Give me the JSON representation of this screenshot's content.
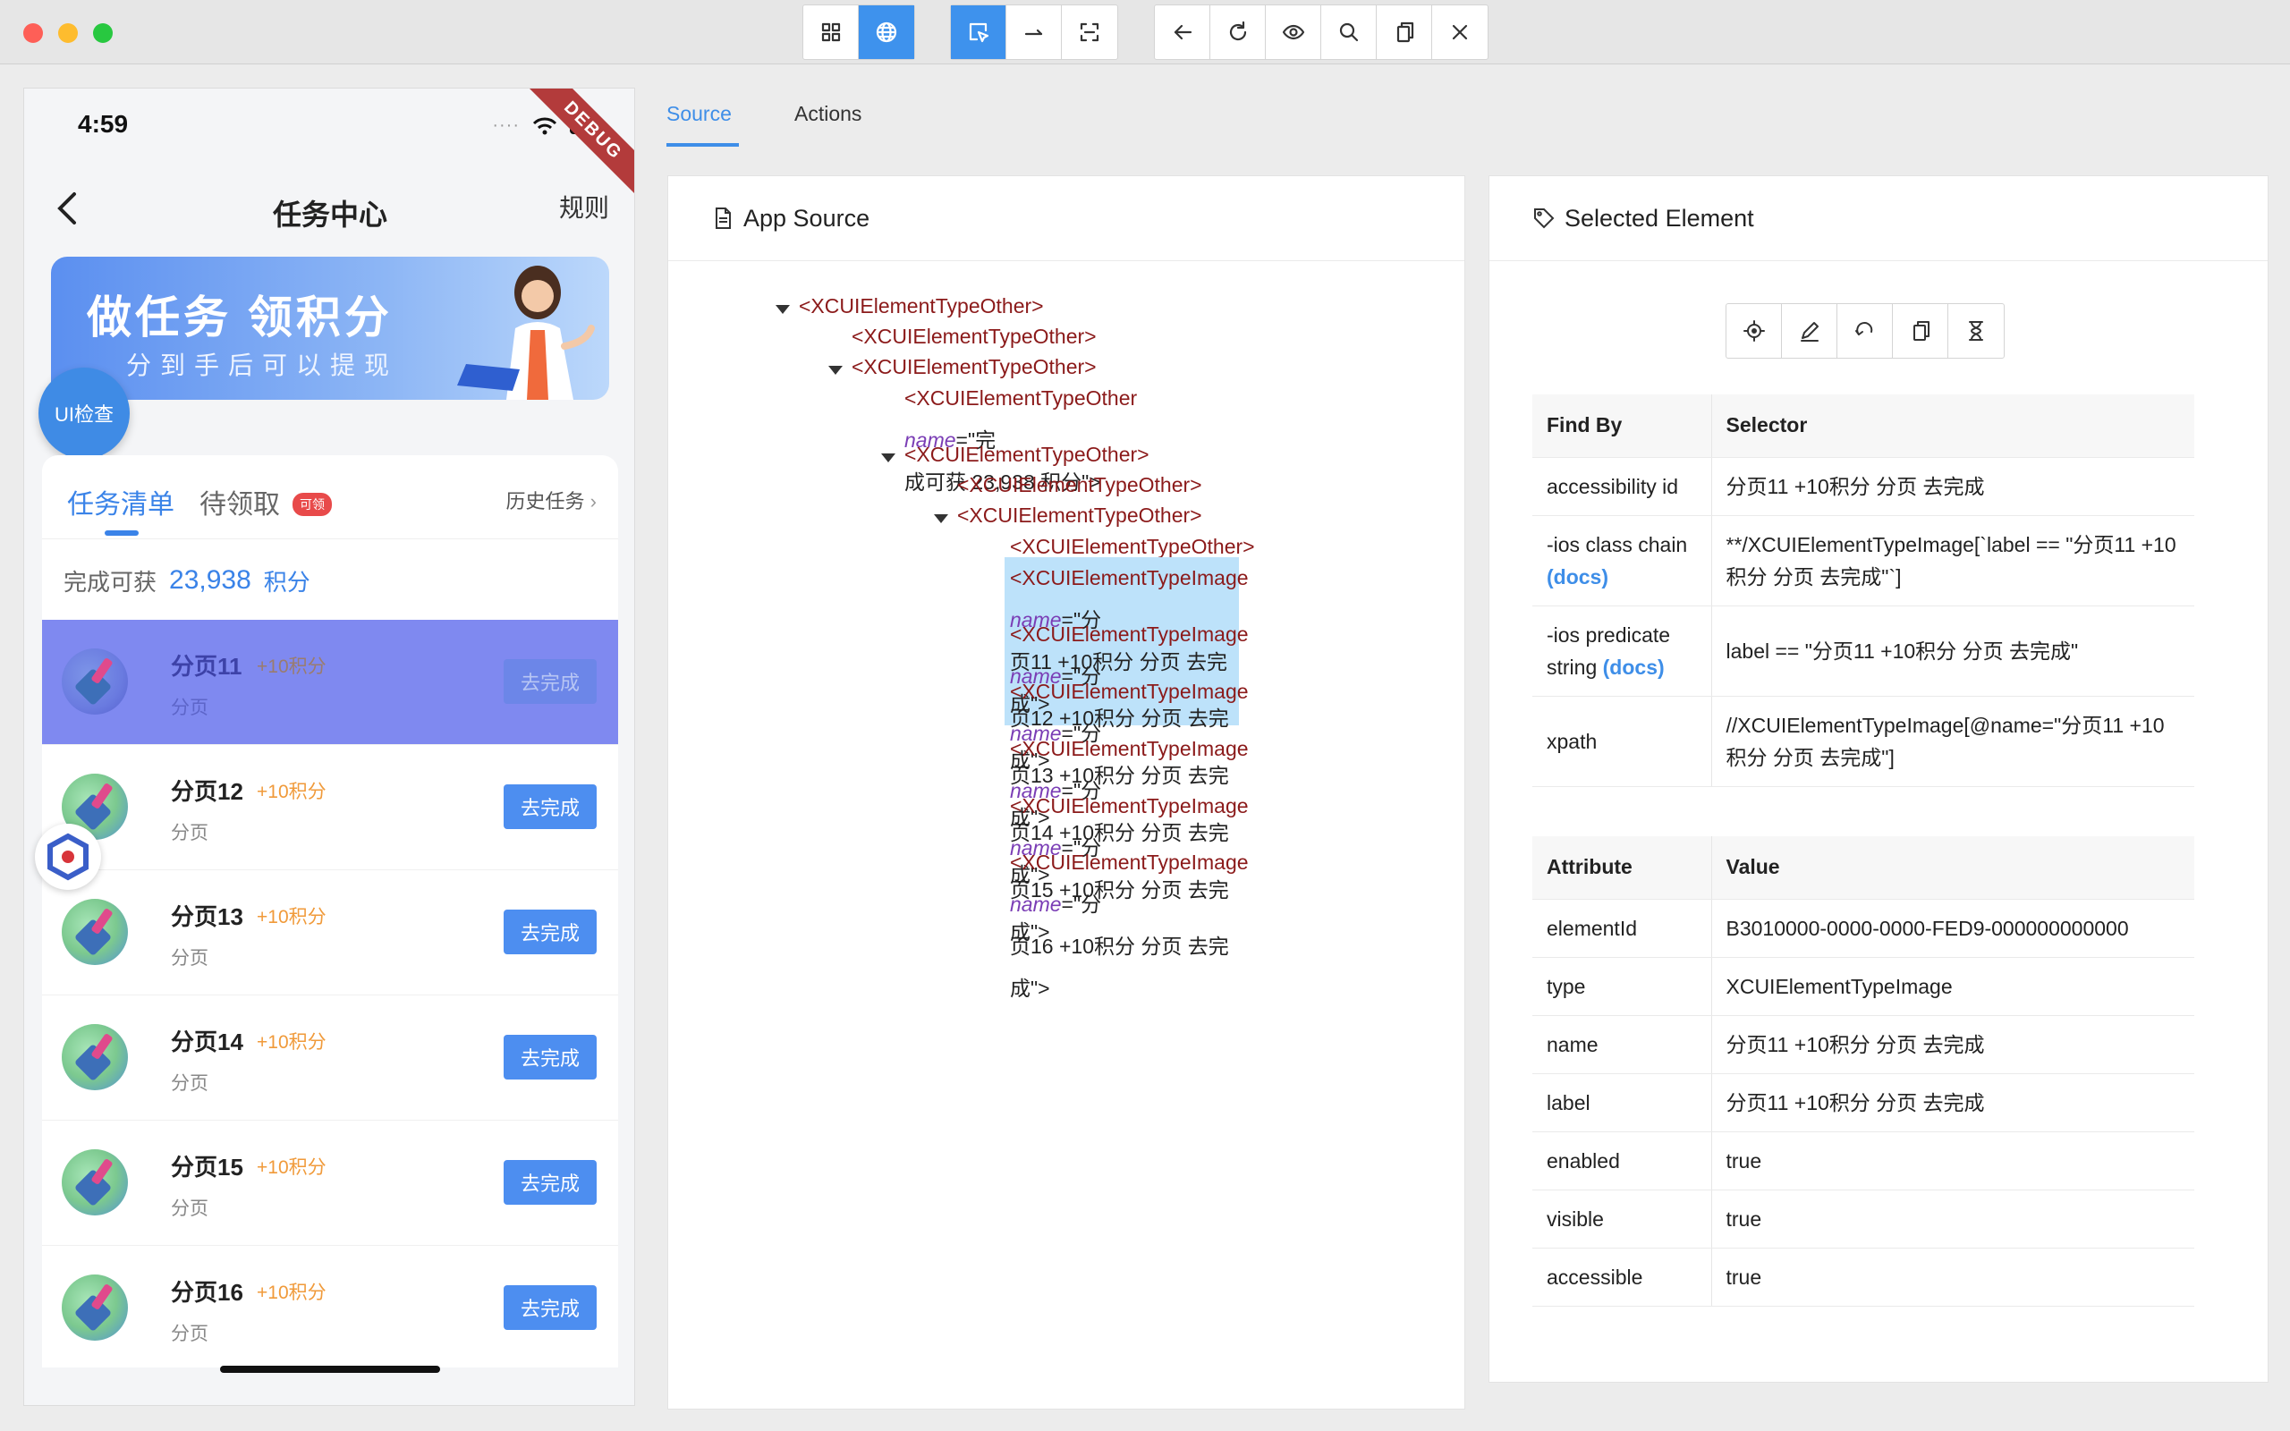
{
  "toolbar": {
    "group1": [
      {
        "icon": "grid-icon"
      },
      {
        "icon": "globe-icon",
        "active": true
      }
    ],
    "group2": [
      {
        "icon": "select-cursor-icon",
        "active": true
      },
      {
        "icon": "swipe-arrow-icon"
      },
      {
        "icon": "screenshot-frame-icon"
      }
    ],
    "group3": [
      {
        "icon": "back-arrow-icon"
      },
      {
        "icon": "refresh-icon"
      },
      {
        "icon": "eye-icon"
      },
      {
        "icon": "search-icon"
      },
      {
        "icon": "copy-icon"
      },
      {
        "icon": "close-icon"
      }
    ]
  },
  "phone": {
    "time": "4:59",
    "debug_label": "DEBUG",
    "nav_title": "任务中心",
    "nav_rule": "规则",
    "banner_title": "做任务 领积分",
    "banner_sub": "分到手后可以提现",
    "ui_check": "UI检查",
    "tab_active": "任务清单",
    "tab_second": "待领取",
    "tab_badge": "可领",
    "history": "历史任务",
    "total_label": "完成可获",
    "total_num": "23,938",
    "total_unit": "积分",
    "tasks": [
      {
        "name": "分页11",
        "points": "+10积分",
        "sub": "分页",
        "button": "去完成",
        "selected": true
      },
      {
        "name": "分页12",
        "points": "+10积分",
        "sub": "分页",
        "button": "去完成"
      },
      {
        "name": "分页13",
        "points": "+10积分",
        "sub": "分页",
        "button": "去完成"
      },
      {
        "name": "分页14",
        "points": "+10积分",
        "sub": "分页",
        "button": "去完成"
      },
      {
        "name": "分页15",
        "points": "+10积分",
        "sub": "分页",
        "button": "去完成"
      },
      {
        "name": "分页16",
        "points": "+10积分",
        "sub": "分页",
        "button": "去完成"
      }
    ]
  },
  "inspector": {
    "tabs": [
      "Source",
      "Actions"
    ],
    "source_title": "App Source",
    "selected_title": "Selected Element",
    "tree": [
      {
        "tag": "<XCUIElementTypeOther>",
        "caret": true
      },
      {
        "tag": "<XCUIElementTypeOther>"
      },
      {
        "tag": "<XCUIElementTypeOther>",
        "caret": true
      },
      {
        "tag": "<XCUIElementTypeOther ",
        "attr": "name",
        "val1": "=\"完",
        "val2": "成可获 23,938 积分\">"
      },
      {
        "tag": "<XCUIElementTypeOther>",
        "caret": true
      },
      {
        "tag": "<XCUIElementTypeOther>"
      },
      {
        "tag": "<XCUIElementTypeOther>",
        "caret": true
      },
      {
        "tag": "<XCUIElementTypeOther>"
      },
      {
        "tag": "<XCUIElementTypeImage ",
        "attr": "name",
        "val1": "=\"分",
        "val2": "页11 +10积分 分页 去完成\">",
        "highlight": true
      },
      {
        "tag": "<XCUIElementTypeImage ",
        "attr": "name",
        "val1": "=\"分",
        "val2": "页12 +10积分 分页 去完成\">"
      },
      {
        "tag": "<XCUIElementTypeImage ",
        "attr": "name",
        "val1": "=\"分",
        "val2": "页13 +10积分 分页 去完成\">"
      },
      {
        "tag": "<XCUIElementTypeImage ",
        "attr": "name",
        "val1": "=\"分",
        "val2": "页14 +10积分 分页 去完成\">"
      },
      {
        "tag": "<XCUIElementTypeImage ",
        "attr": "name",
        "val1": "=\"分",
        "val2": "页15 +10积分 分页 去完成\">"
      },
      {
        "tag": "<XCUIElementTypeImage ",
        "attr": "name",
        "val1": "=\"分",
        "val2": "页16 +10积分 分页 去完成\">"
      }
    ],
    "selector_headers": [
      "Find By",
      "Selector"
    ],
    "selectors": [
      {
        "by": "accessibility id",
        "value": "分页11 +10积分 分页 去完成"
      },
      {
        "by": "-ios class chain",
        "docs": "(docs)",
        "value": "**/XCUIElementTypeImage[`label == \"分页11 +10积分 分页 去完成\"`]"
      },
      {
        "by": "-ios predicate string",
        "docs": "(docs)",
        "value": "label == \"分页11 +10积分 分页 去完成\""
      },
      {
        "by": "xpath",
        "value": "//XCUIElementTypeImage[@name=\"分页11 +10积分 分页 去完成\"]"
      }
    ],
    "attr_headers": [
      "Attribute",
      "Value"
    ],
    "attributes": [
      {
        "name": "elementId",
        "value": "B3010000-0000-0000-FED9-000000000000"
      },
      {
        "name": "type",
        "value": "XCUIElementTypeImage"
      },
      {
        "name": "name",
        "value": "分页11 +10积分 分页 去完成"
      },
      {
        "name": "label",
        "value": "分页11 +10积分 分页 去完成"
      },
      {
        "name": "enabled",
        "value": "true"
      },
      {
        "name": "visible",
        "value": "true"
      },
      {
        "name": "accessible",
        "value": "true"
      }
    ],
    "element_tools": [
      "tap-target-icon",
      "edit-icon",
      "refresh-icon",
      "copy-icon",
      "hourglass-icon"
    ]
  }
}
